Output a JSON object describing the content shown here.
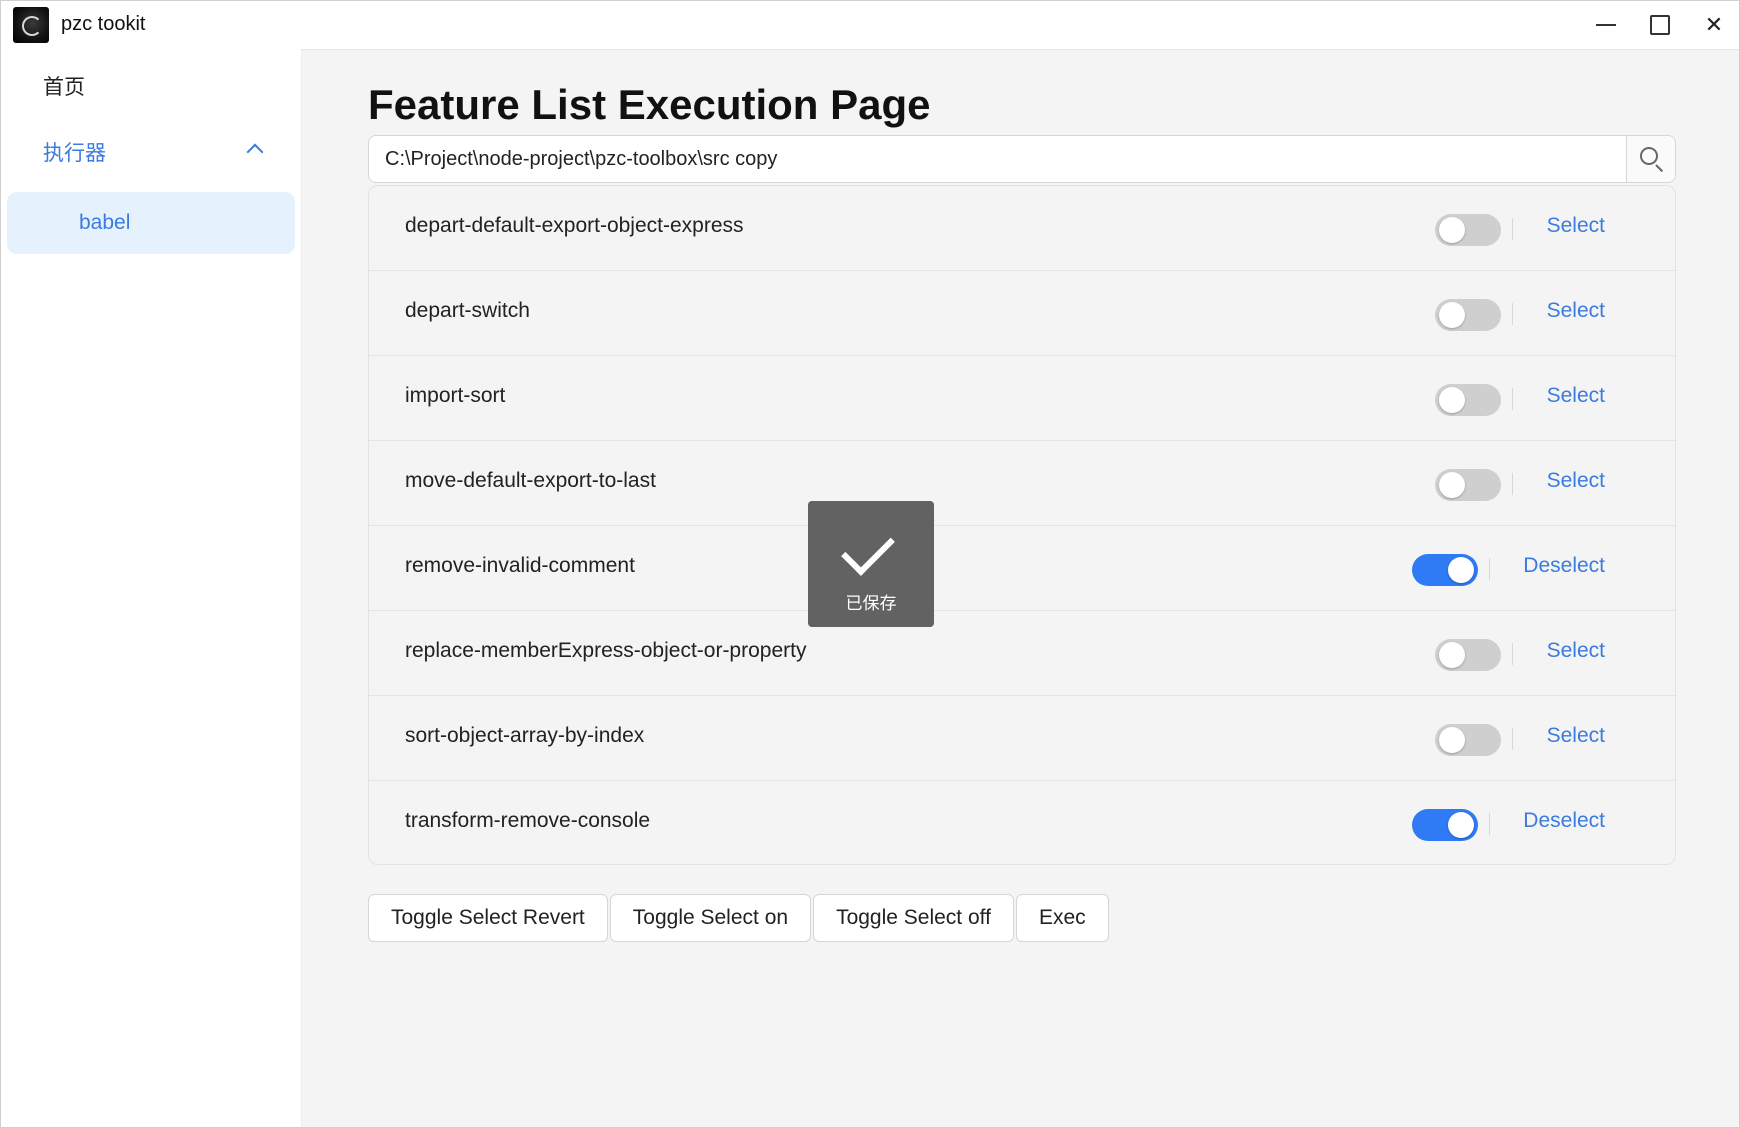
{
  "window": {
    "title": "pzc tookit"
  },
  "sidebar": {
    "home_label": "首页",
    "executor_label": "执行器",
    "items": [
      {
        "label": "babel"
      }
    ]
  },
  "main": {
    "title": "Feature List Execution Page",
    "path_value": "C:\\Project\\node-project\\pzc-toolbox\\src copy",
    "features": [
      {
        "name": "depart-default-export-object-express",
        "enabled": false,
        "action": "Select"
      },
      {
        "name": "depart-switch",
        "enabled": false,
        "action": "Select"
      },
      {
        "name": "import-sort",
        "enabled": false,
        "action": "Select"
      },
      {
        "name": "move-default-export-to-last",
        "enabled": false,
        "action": "Select"
      },
      {
        "name": "remove-invalid-comment",
        "enabled": true,
        "action": "Deselect"
      },
      {
        "name": "replace-memberExpress-object-or-property",
        "enabled": false,
        "action": "Select"
      },
      {
        "name": "sort-object-array-by-index",
        "enabled": false,
        "action": "Select"
      },
      {
        "name": "transform-remove-console",
        "enabled": true,
        "action": "Deselect"
      }
    ],
    "buttons": {
      "toggle_revert": "Toggle Select Revert",
      "toggle_on": "Toggle Select on",
      "toggle_off": "Toggle Select off",
      "exec": "Exec"
    }
  },
  "toast": {
    "message": "已保存",
    "icon": "check-icon"
  },
  "colors": {
    "accent": "#3b7be0",
    "toggle_on": "#2f7af5",
    "toggle_off": "#cfcfcf"
  },
  "icons": {
    "app": "app-logo-icon",
    "search": "search-icon",
    "collapse": "chevron-up-icon",
    "minimize": "minimize-icon",
    "maximize": "maximize-icon",
    "close": "close-icon"
  }
}
